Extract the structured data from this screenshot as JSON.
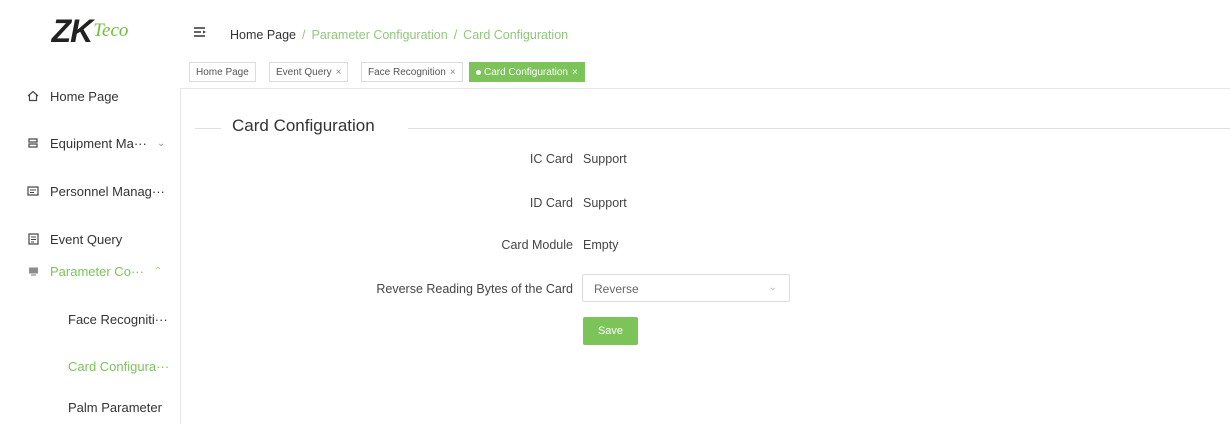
{
  "logo": {
    "main": "ZK",
    "sub": "Teco"
  },
  "sidebar": {
    "items": [
      {
        "label": "Home Page",
        "icon": "home-icon"
      },
      {
        "label": "Equipment Ma···",
        "icon": "equipment-icon"
      },
      {
        "label": "Personnel Manag···",
        "icon": "personnel-icon"
      },
      {
        "label": "Event Query",
        "icon": "document-icon"
      },
      {
        "label": "Parameter Co···",
        "icon": "parameter-icon"
      }
    ],
    "subitems": [
      {
        "label": "Face Recogniti···"
      },
      {
        "label": "Card Configura···"
      },
      {
        "label": "Palm Parameter"
      }
    ]
  },
  "breadcrumb": {
    "home": "Home Page",
    "sep": "/",
    "level1": "Parameter Configuration",
    "level2": "Card Configuration"
  },
  "tabs": [
    {
      "label": "Home Page"
    },
    {
      "label": "Event Query"
    },
    {
      "label": "Face Recognition"
    },
    {
      "label": "Card Configuration"
    }
  ],
  "tab_close": "×",
  "main": {
    "title": "Card Configuration",
    "fields": [
      {
        "label": "IC Card",
        "value": "Support"
      },
      {
        "label": "ID Card",
        "value": "Support"
      },
      {
        "label": "Card Module",
        "value": "Empty"
      }
    ],
    "reverse": {
      "label": "Reverse Reading Bytes of the Card",
      "value": "Reverse"
    },
    "save_label": "Save"
  },
  "colors": {
    "accent": "#7cc35a"
  }
}
